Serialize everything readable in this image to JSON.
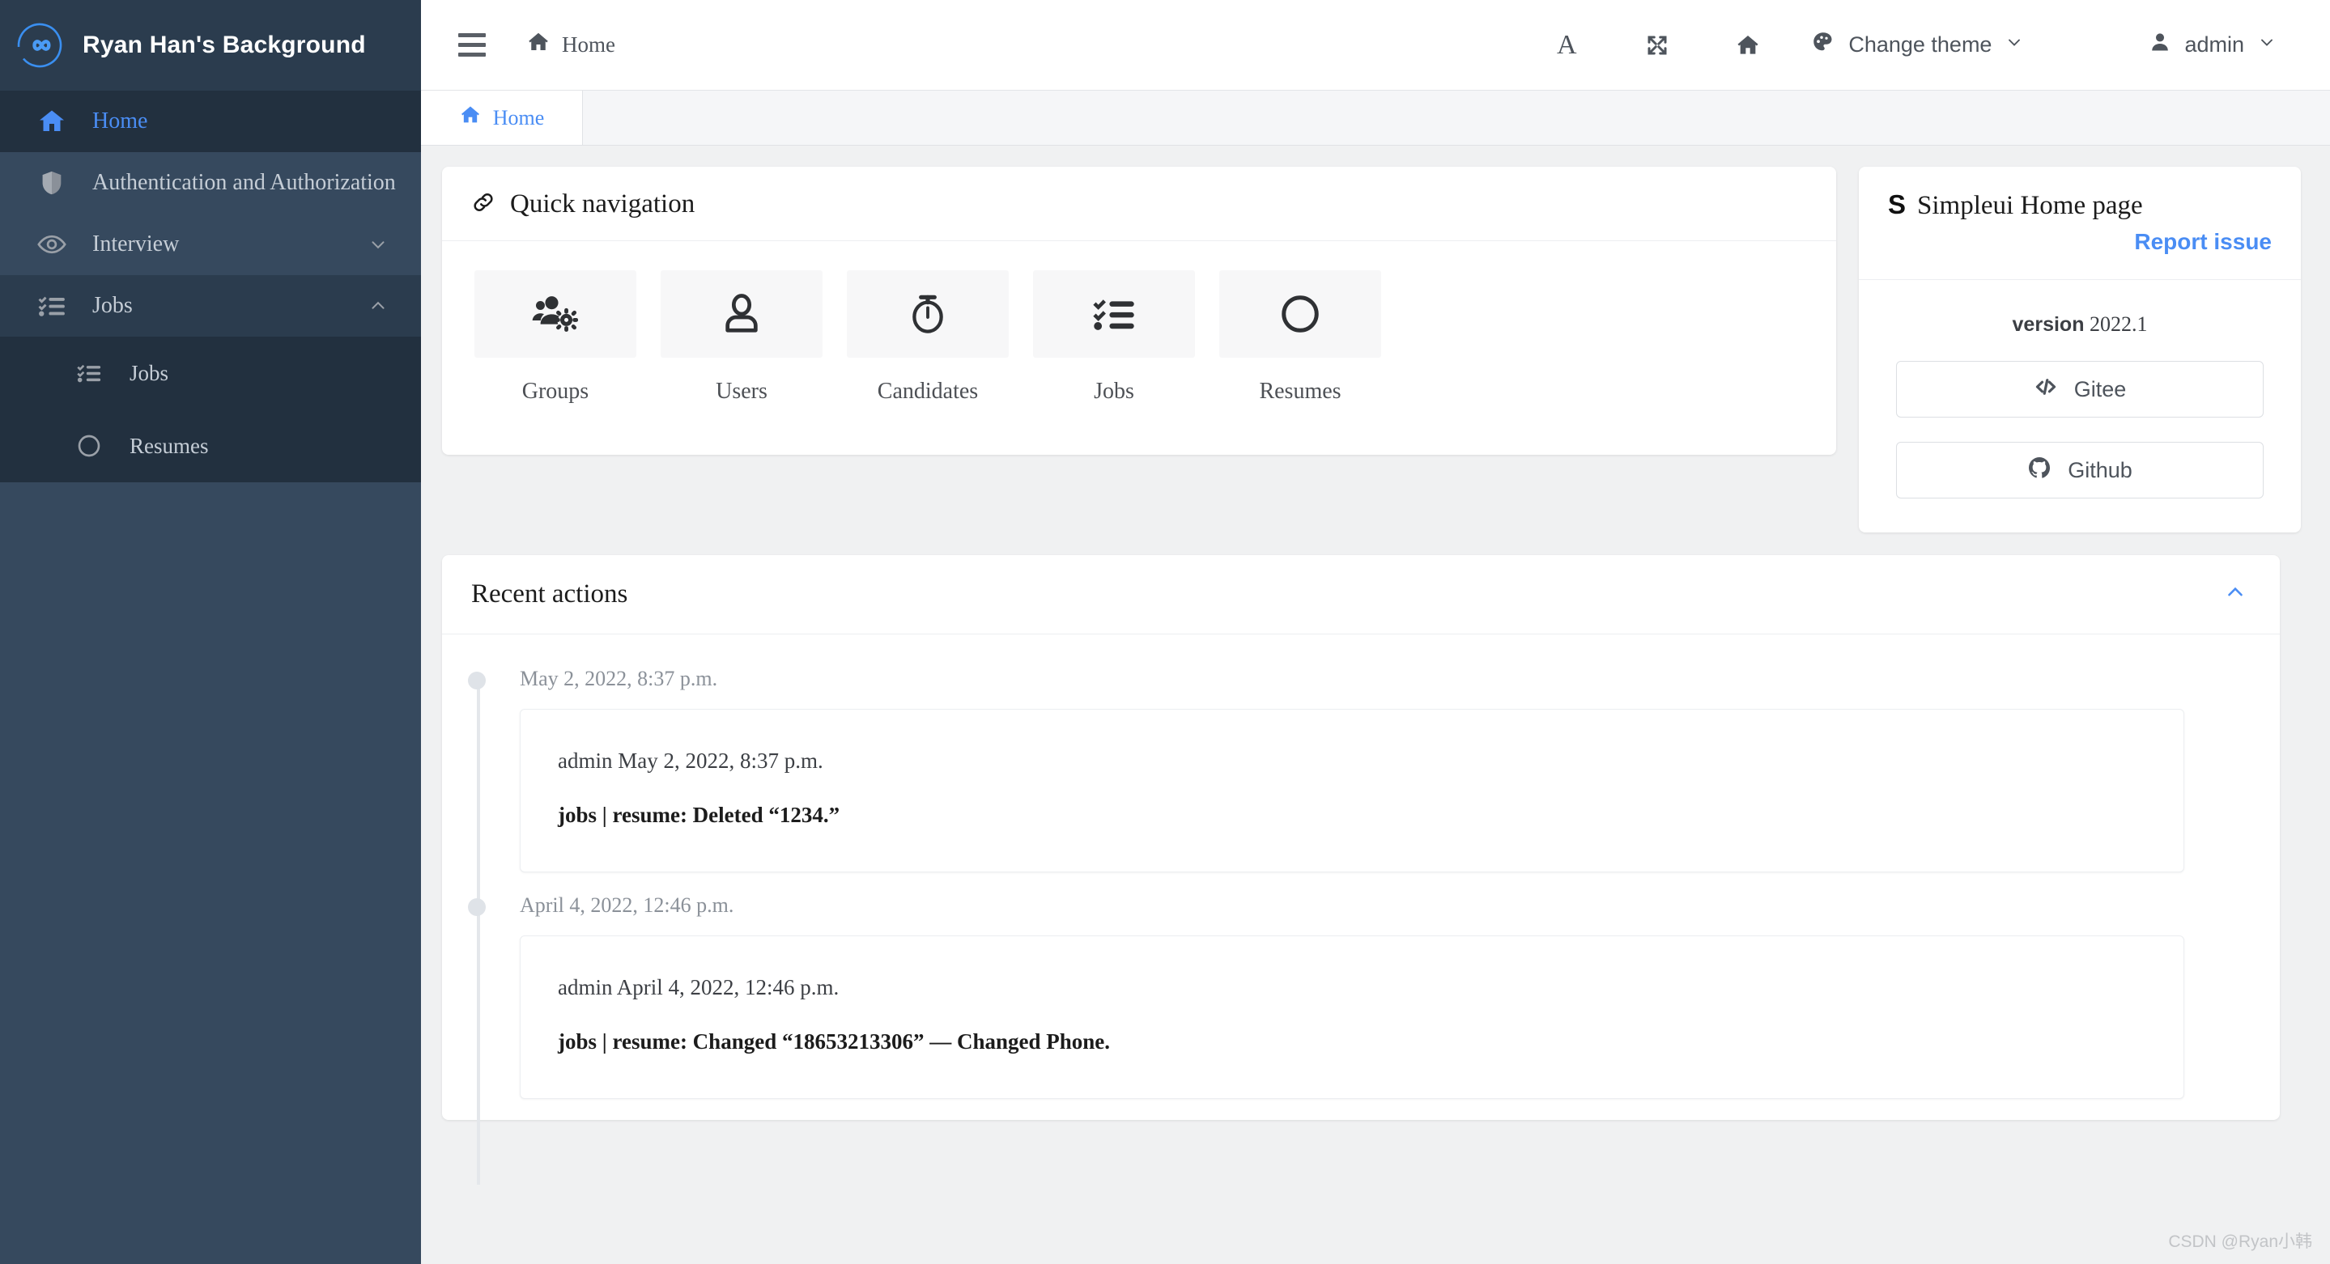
{
  "brand": {
    "title": "Ryan Han's Background",
    "logo_icon": "infinity-circle-logo"
  },
  "sidebar": {
    "items": [
      {
        "label": "Home",
        "icon": "home-icon",
        "active": true,
        "expandable": false
      },
      {
        "label": "Authentication and Authorization",
        "icon": "shield-icon",
        "active": false,
        "expandable": false
      },
      {
        "label": "Interview",
        "icon": "eye-icon",
        "active": false,
        "expandable": true,
        "expanded": false
      },
      {
        "label": "Jobs",
        "icon": "tasks-list-icon",
        "active": false,
        "expandable": true,
        "expanded": true
      }
    ],
    "jobs_submenu": [
      {
        "label": "Jobs",
        "icon": "tasks-list-icon"
      },
      {
        "label": "Resumes",
        "icon": "circle-icon"
      }
    ]
  },
  "topbar": {
    "menu_toggle_icon": "hamburger-icon",
    "home_label": "Home",
    "home_icon": "home-icon",
    "font_size_icon": "A",
    "fullscreen_icon": "expand-arrows-icon",
    "home_shortcut_icon": "home-icon",
    "theme_icon": "palette-icon",
    "theme_label": "Change theme",
    "user_icon": "user-icon",
    "user_label": "admin",
    "chevron_icon": "chevron-down-icon"
  },
  "tabs": [
    {
      "label": "Home",
      "icon": "home-icon",
      "active": true
    }
  ],
  "quick_navigation": {
    "title": "Quick navigation",
    "icon": "link-icon",
    "tiles": [
      {
        "label": "Groups",
        "icon": "users-cog-icon"
      },
      {
        "label": "Users",
        "icon": "user-outline-icon"
      },
      {
        "label": "Candidates",
        "icon": "stopwatch-icon"
      },
      {
        "label": "Jobs",
        "icon": "tasks-list-icon"
      },
      {
        "label": "Resumes",
        "icon": "circle-icon"
      }
    ]
  },
  "info_card": {
    "badge": "S",
    "title": "Simpleui Home page",
    "report_link": "Report issue",
    "version_label": "version",
    "version_value": "2022.1",
    "buttons": [
      {
        "label": "Gitee",
        "icon": "code-brackets-icon"
      },
      {
        "label": "Github",
        "icon": "github-icon"
      }
    ]
  },
  "recent_actions": {
    "title": "Recent actions",
    "collapse_icon": "chevron-up-icon",
    "entries": [
      {
        "time": "May 2, 2022, 8:37 p.m.",
        "meta": "admin May 2, 2022, 8:37 p.m.",
        "action": "jobs | resume: Deleted “1234.”"
      },
      {
        "time": "April 4, 2022, 12:46 p.m.",
        "meta": "admin April 4, 2022, 12:46 p.m.",
        "action": "jobs | resume: Changed “18653213306” — Changed Phone."
      }
    ]
  },
  "watermark": "CSDN @Ryan小韩",
  "colors": {
    "sidebar_bg": "#36495e",
    "sidebar_dark": "#22303f",
    "brand_bg": "#2b3c4e",
    "accent_blue": "#4a8df4",
    "page_bg": "#f0f1f2"
  }
}
